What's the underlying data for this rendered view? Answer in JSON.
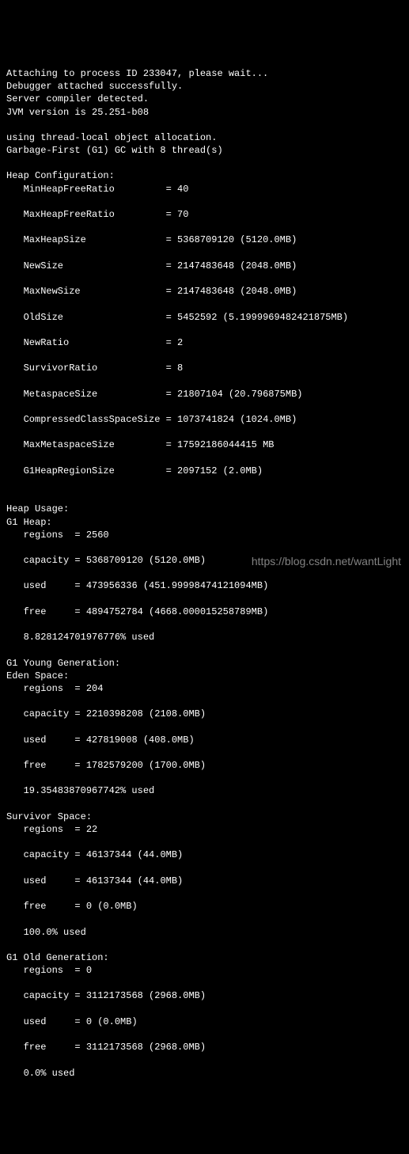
{
  "header": {
    "attach": "Attaching to process ID 233047, please wait...",
    "attached": "Debugger attached successfully.",
    "compiler": "Server compiler detected.",
    "jvm": "JVM version is 25.251-b08"
  },
  "alloc": {
    "thread_local": "using thread-local object allocation.",
    "gc": "Garbage-First (G1) GC with 8 thread(s)"
  },
  "heap_config_title": "Heap Configuration:",
  "heap_config": {
    "MinHeapFreeRatio": "40",
    "MaxHeapFreeRatio": "70",
    "MaxHeapSize": "5368709120 (5120.0MB)",
    "NewSize": "2147483648 (2048.0MB)",
    "MaxNewSize": "2147483648 (2048.0MB)",
    "OldSize": "5452592 (5.1999969482421875MB)",
    "NewRatio": "2",
    "SurvivorRatio": "8",
    "MetaspaceSize": "21807104 (20.796875MB)",
    "CompressedClassSpaceSize": "1073741824 (1024.0MB)",
    "MaxMetaspaceSize": "17592186044415 MB",
    "G1HeapRegionSize": "2097152 (2.0MB)"
  },
  "heap_usage_title": "Heap Usage:",
  "g1_heap_title": "G1 Heap:",
  "g1_heap": {
    "regions": "2560",
    "capacity": "5368709120 (5120.0MB)",
    "used": "473956336 (451.99998474121094MB)",
    "free": "4894752784 (4668.000015258789MB)",
    "pct": "8.828124701976776% used"
  },
  "g1_young_title": "G1 Young Generation:",
  "eden_title": "Eden Space:",
  "eden": {
    "regions": "204",
    "capacity": "2210398208 (2108.0MB)",
    "used": "427819008 (408.0MB)",
    "free": "1782579200 (1700.0MB)",
    "pct": "19.35483870967742% used"
  },
  "survivor_title": "Survivor Space:",
  "survivor": {
    "regions": "22",
    "capacity": "46137344 (44.0MB)",
    "used": "46137344 (44.0MB)",
    "free": "0 (0.0MB)",
    "pct": "100.0% used"
  },
  "g1_old_title": "G1 Old Generation:",
  "old": {
    "regions": "0",
    "capacity": "3112173568 (2968.0MB)",
    "used": "0 (0.0MB)",
    "free": "3112173568 (2968.0MB)",
    "pct": "0.0% used"
  },
  "watermark": "https://blog.csdn.net/wantLight"
}
